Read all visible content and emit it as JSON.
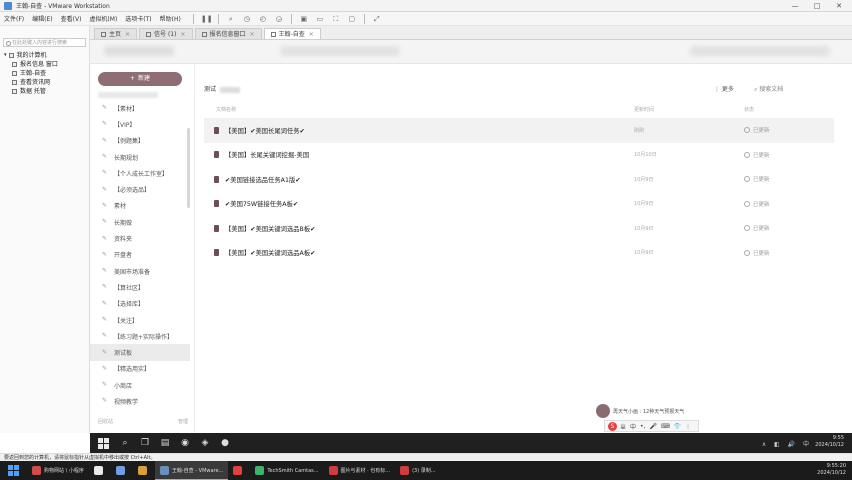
{
  "window": {
    "title": "王翰-自查 - VMware Workstation",
    "buttons": [
      "—",
      "□",
      "✕"
    ]
  },
  "menu": [
    "文件(F)",
    "编辑(E)",
    "查看(V)",
    "虚拟机(M)",
    "选项卡(T)",
    "帮助(H)"
  ],
  "library": {
    "search_placeholder": "在此处键入内容进行搜索",
    "items": [
      {
        "label": "我的计算机",
        "child": false
      },
      {
        "label": "报名信息 窗口",
        "child": true
      },
      {
        "label": "王翰-自查",
        "child": true
      },
      {
        "label": "查看资讯网",
        "child": true
      },
      {
        "label": "数据 托管",
        "child": true
      }
    ]
  },
  "vm_tabs": [
    {
      "label": "主页",
      "active": false
    },
    {
      "label": "信号 (1)",
      "active": false
    },
    {
      "label": "报名信息窗口",
      "active": false
    },
    {
      "label": "王翰-自查",
      "active": true
    }
  ],
  "app": {
    "new_button": "新建",
    "nav": [
      {
        "label": "【素材】",
        "active": false
      },
      {
        "label": "【VIP】",
        "active": false
      },
      {
        "label": "【例题集】",
        "active": false
      },
      {
        "label": "长期规划",
        "active": false
      },
      {
        "label": "【个人成长工作室】",
        "active": false
      },
      {
        "label": "【必须选品】",
        "active": false
      },
      {
        "label": "素材",
        "active": false
      },
      {
        "label": "长期做",
        "active": false
      },
      {
        "label": "资料夹",
        "active": false
      },
      {
        "label": "开盘者",
        "active": false
      },
      {
        "label": "美国市场准备",
        "active": false
      },
      {
        "label": "【算社区】",
        "active": false
      },
      {
        "label": "【选择库】",
        "active": false
      },
      {
        "label": "【关注】",
        "active": false
      },
      {
        "label": "【练习题+实际操作】",
        "active": false
      },
      {
        "label": "测试板",
        "active": true
      },
      {
        "label": "【精选用实】",
        "active": false
      },
      {
        "label": "小商店",
        "active": false
      },
      {
        "label": "视频教学",
        "active": false
      }
    ],
    "footer_left": "回收站",
    "footer_right": "管理"
  },
  "main": {
    "folder_title": "测试",
    "more": "更多",
    "search": "搜索文档",
    "col_name": "文档名称",
    "col_time": "更新时间",
    "col_status": "状态",
    "rows": [
      {
        "name": "【美国】✔美国长尾词任务✔",
        "time": "刚刚",
        "status": "已更新",
        "highlight": true
      },
      {
        "name": "【美国】长尾关键词挖掘-美国",
        "time": "10月10日",
        "status": "已更新",
        "highlight": false
      },
      {
        "name": "✔美国链接选品任务A1版✔",
        "time": "10月9日",
        "status": "已更新",
        "highlight": false
      },
      {
        "name": "✔美国75W链接任务A板✔",
        "time": "10月9日",
        "status": "已更新",
        "highlight": false
      },
      {
        "name": "【美国】✔美国关键词选品B板✔",
        "time": "10月9日",
        "status": "已更新",
        "highlight": false
      },
      {
        "name": "【美国】✔美国关键词选品A板✔",
        "time": "10月9日",
        "status": "已更新",
        "highlight": false
      }
    ]
  },
  "ime": {
    "text": "再天气小画 : 12种天气预报天气",
    "tools": [
      "S",
      "ㄓ",
      "中",
      "•,",
      "🎤",
      "⌨",
      "👕",
      "⋮"
    ]
  },
  "guest_taskbar": {
    "time": "9:55",
    "date": "2024/10/12"
  },
  "statusbar": {
    "text": "要返回到您的计算机，请将鼠标指针从虚拟机中移出或按 Ctrl+Alt。"
  },
  "host_taskbar": {
    "items": [
      {
        "label": "购物网站 \\ 小程序",
        "color": "#d14b4b"
      },
      {
        "label": "",
        "color": "#eaeaea"
      },
      {
        "label": "",
        "color": "#6ea0e0"
      },
      {
        "label": "",
        "color": "#d9a03a"
      },
      {
        "label": "王翰-自查 - VMware...",
        "color": "#6a8fbf",
        "active": true
      },
      {
        "label": "",
        "color": "#e0413e"
      },
      {
        "label": "TechSmith Camtas...",
        "color": "#3bb36a"
      },
      {
        "label": "图片与素材 · 也有标...",
        "color": "#d23b3b"
      },
      {
        "label": "(3) 录制...",
        "color": "#d23b3b"
      }
    ],
    "time": "9:55:20",
    "date": "2024/10/12"
  },
  "colors": {
    "accent": "#8e6e73",
    "doc_icon": "#6b4f54"
  }
}
